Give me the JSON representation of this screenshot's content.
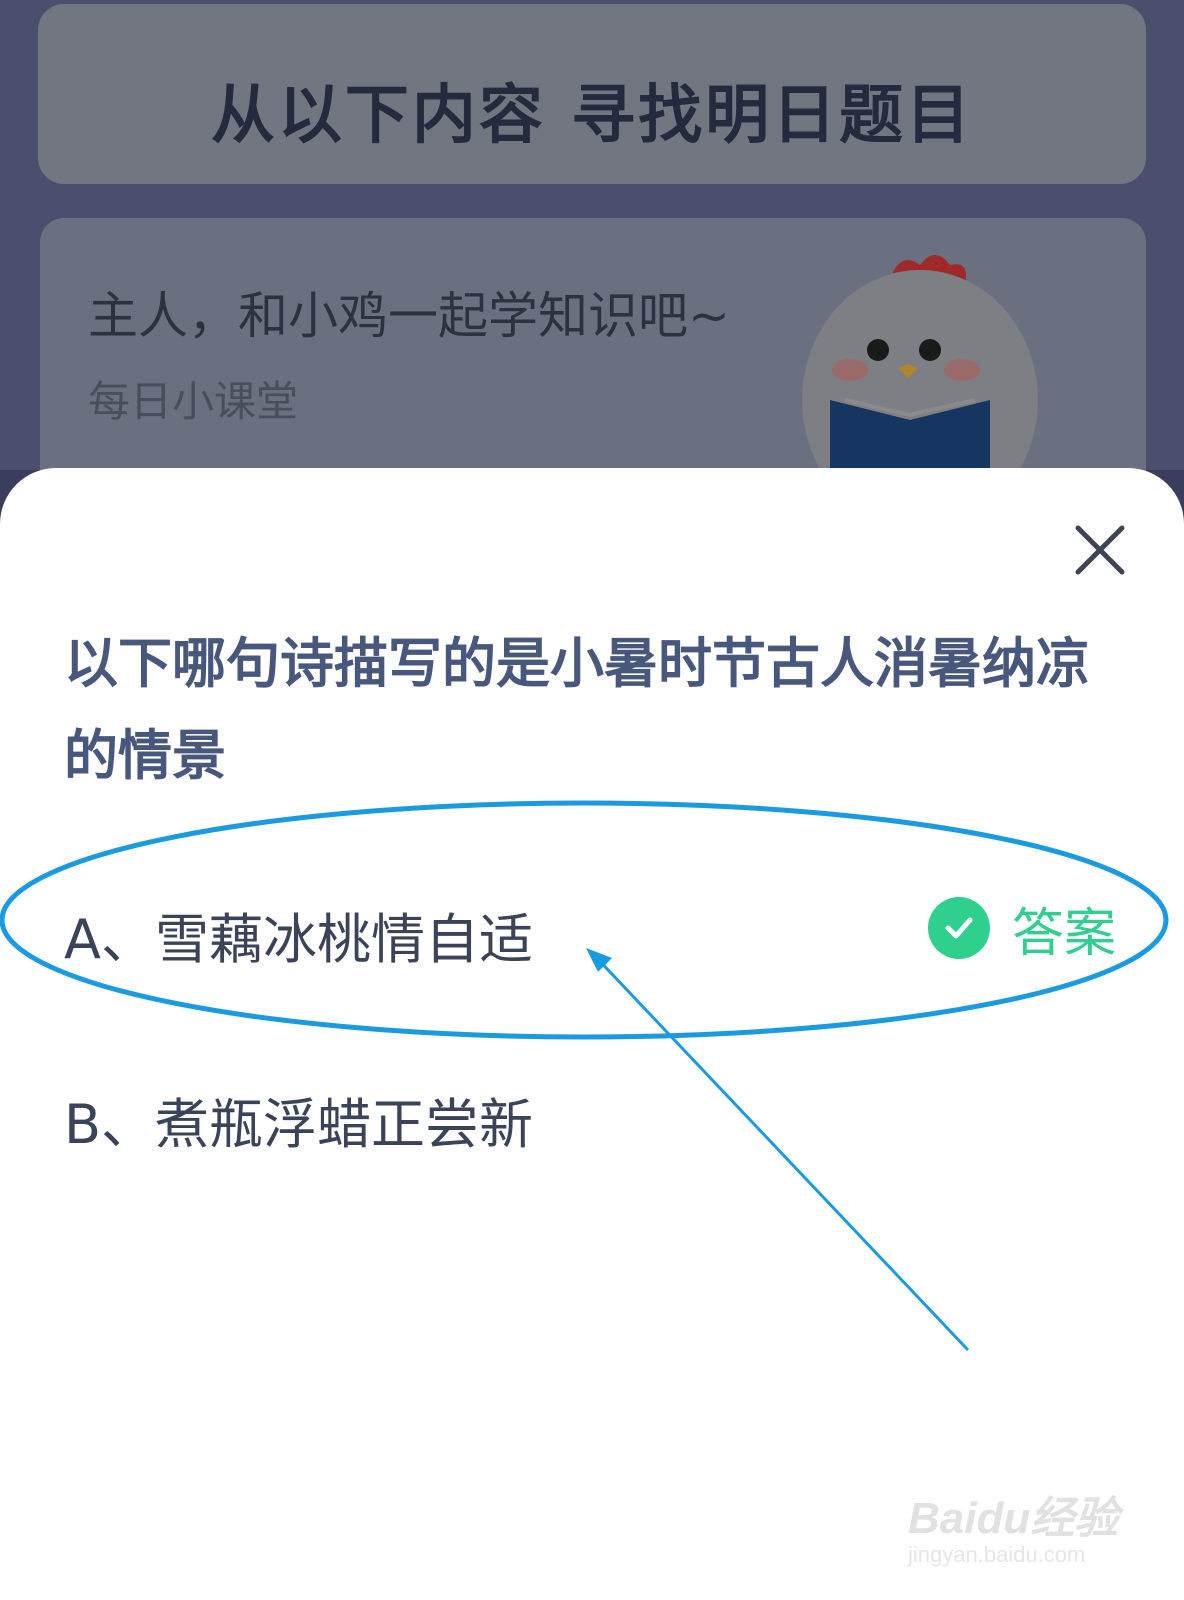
{
  "background": {
    "banner_title": "从以下内容  寻找明日题目",
    "lesson_title": "主人，和小鸡一起学知识吧~",
    "lesson_subtitle": "每日小课堂"
  },
  "quiz": {
    "question": "以下哪句诗描写的是小暑时节古人消暑纳凉的情景",
    "options": [
      {
        "text": "A、雪藕冰桃情自适",
        "is_answer": true
      },
      {
        "text": "B、煮瓶浮蜡正尝新",
        "is_answer": false
      }
    ],
    "answer_label": "答案"
  },
  "watermark": {
    "brand": "Baidu经验",
    "url": "jingyan.baidu.com"
  },
  "colors": {
    "accent_green": "#2fcf8e",
    "annotation_blue": "#1a9ae0",
    "question_text": "#48577c"
  },
  "icons": [
    "close-icon",
    "check-icon",
    "chick-mascot"
  ]
}
